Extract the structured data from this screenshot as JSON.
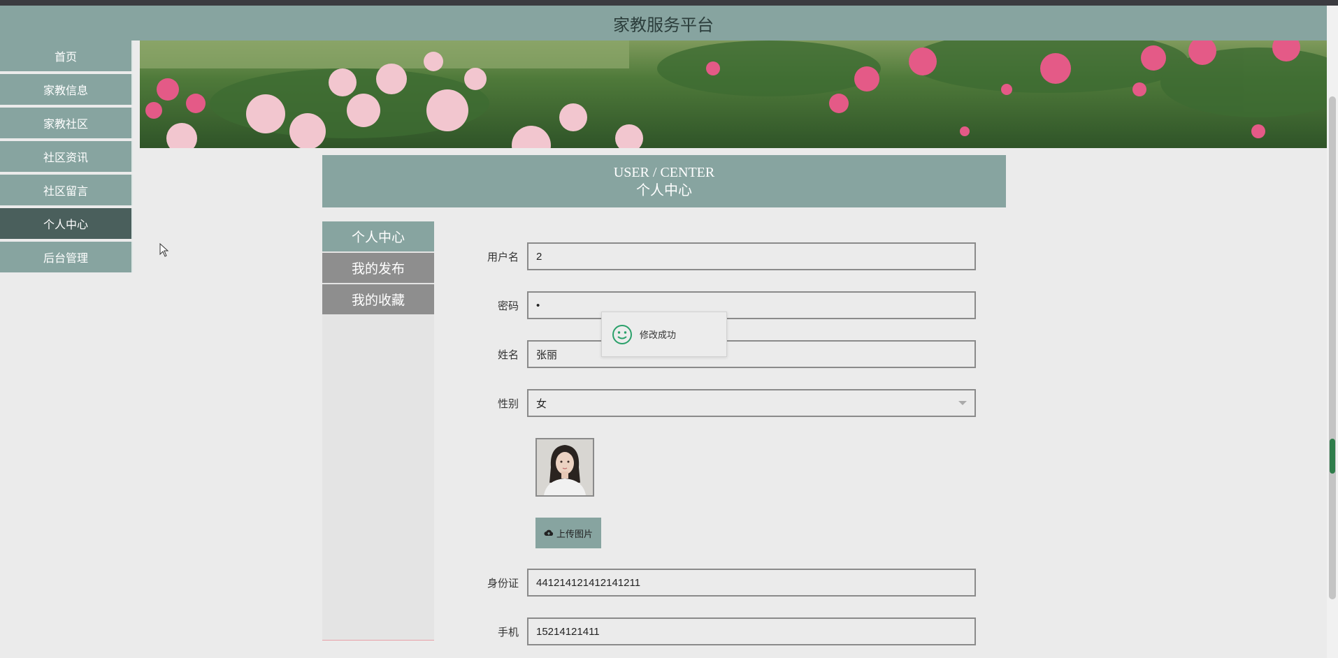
{
  "app": {
    "title": "家教服务平台"
  },
  "sidebar": {
    "items": [
      {
        "label": "首页"
      },
      {
        "label": "家教信息"
      },
      {
        "label": "家教社区"
      },
      {
        "label": "社区资讯"
      },
      {
        "label": "社区留言"
      },
      {
        "label": "个人中心"
      },
      {
        "label": "后台管理"
      }
    ],
    "active": "个人中心"
  },
  "page_header": {
    "en": "USER / CENTER",
    "cn": "个人中心"
  },
  "subnav": {
    "items": [
      {
        "label": "个人中心"
      },
      {
        "label": "我的发布"
      },
      {
        "label": "我的收藏"
      }
    ]
  },
  "form": {
    "username": {
      "label": "用户名",
      "value": "2"
    },
    "password": {
      "label": "密码",
      "value": "•"
    },
    "name": {
      "label": "姓名",
      "value": "张丽"
    },
    "gender": {
      "label": "性别",
      "value": "女"
    },
    "upload_label": "上传图片",
    "id_card": {
      "label": "身份证",
      "value": "441214121412141211"
    },
    "phone": {
      "label": "手机",
      "value": "15214121411"
    }
  },
  "toast": {
    "message": "修改成功"
  },
  "colors": {
    "accent": "#87a4a0",
    "active_nav": "#4a5f5c",
    "secondary": "#8e8e8e"
  }
}
